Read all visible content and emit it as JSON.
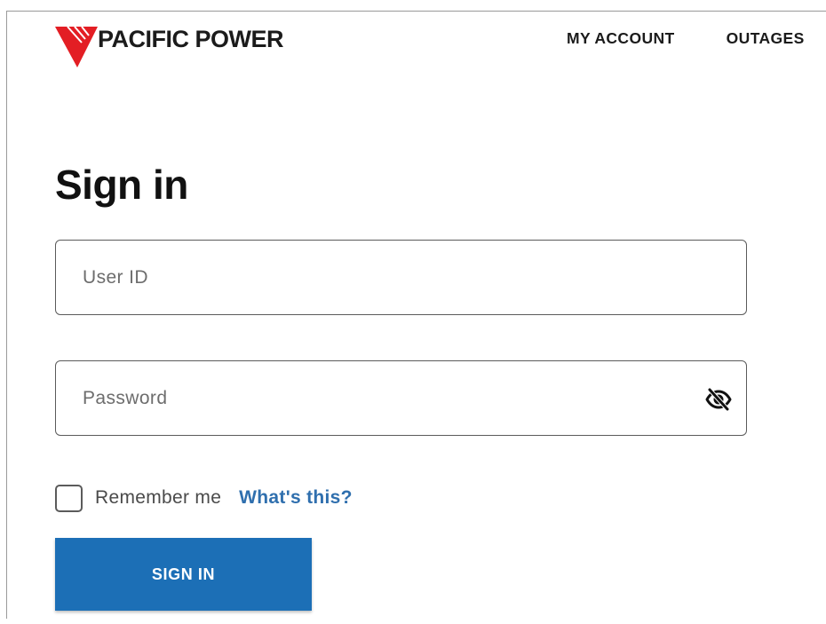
{
  "brand": {
    "name": "PACIFIC POWER",
    "accent_color": "#e31e24",
    "icon": "pacific-power-bolt-logo"
  },
  "nav": {
    "items": [
      {
        "label": "MY ACCOUNT"
      },
      {
        "label": "OUTAGES"
      }
    ]
  },
  "page": {
    "title": "Sign in"
  },
  "form": {
    "user_id": {
      "placeholder": "User ID",
      "value": ""
    },
    "password": {
      "placeholder": "Password",
      "value": "",
      "toggle_icon": "eye-slash-icon"
    },
    "remember": {
      "label": "Remember me",
      "checked": false
    },
    "whats_this": "What's this?",
    "submit_label": "SIGN IN"
  },
  "colors": {
    "primary_button": "#1c6fb6",
    "link": "#2f6fae"
  }
}
